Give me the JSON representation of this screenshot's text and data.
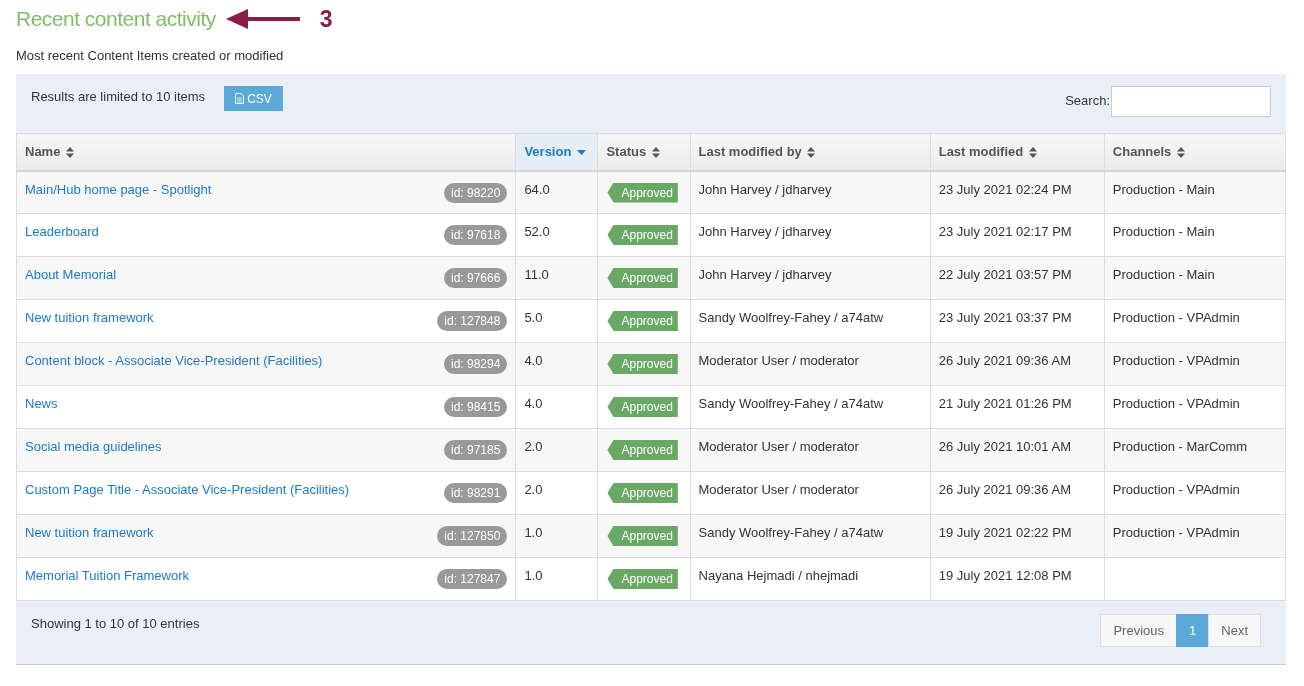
{
  "heading": "Recent content activity",
  "annotation": {
    "label": "3"
  },
  "subtitle": "Most recent Content Items created or modified",
  "toolbar": {
    "limit_text": "Results are limited to 10 items",
    "export_button": "CSV",
    "search_label": "Search:"
  },
  "table": {
    "columns": [
      {
        "label": "Name",
        "sorted": false
      },
      {
        "label": "Version",
        "sorted": true
      },
      {
        "label": "Status",
        "sorted": false
      },
      {
        "label": "Last modified by",
        "sorted": false
      },
      {
        "label": "Last modified",
        "sorted": false
      },
      {
        "label": "Channels",
        "sorted": false
      }
    ],
    "rows": [
      {
        "name": "Main/Hub home page - Spotlight",
        "id": "id: 98220",
        "version": "64.0",
        "status": "Approved",
        "modified_by": "John Harvey / jdharvey",
        "modified": "23 July 2021 02:24 PM",
        "channel": "Production - Main"
      },
      {
        "name": "Leaderboard",
        "id": "id: 97618",
        "version": "52.0",
        "status": "Approved",
        "modified_by": "John Harvey / jdharvey",
        "modified": "23 July 2021 02:17 PM",
        "channel": "Production - Main"
      },
      {
        "name": "About Memorial",
        "id": "id: 97666",
        "version": "11.0",
        "status": "Approved",
        "modified_by": "John Harvey / jdharvey",
        "modified": "22 July 2021 03:57 PM",
        "channel": "Production - Main"
      },
      {
        "name": "New tuition framework",
        "id": "id: 127848",
        "version": "5.0",
        "status": "Approved",
        "modified_by": "Sandy Woolfrey-Fahey / a74atw",
        "modified": "23 July 2021 03:37 PM",
        "channel": "Production - VPAdmin"
      },
      {
        "name": "Content block - Associate Vice-President (Facilities)",
        "id": "id: 98294",
        "version": "4.0",
        "status": "Approved",
        "modified_by": "Moderator User / moderator",
        "modified": "26 July 2021 09:36 AM",
        "channel": "Production - VPAdmin"
      },
      {
        "name": "News",
        "id": "id: 98415",
        "version": "4.0",
        "status": "Approved",
        "modified_by": "Sandy Woolfrey-Fahey / a74atw",
        "modified": "21 July 2021 01:26 PM",
        "channel": "Production - VPAdmin"
      },
      {
        "name": "Social media guidelines",
        "id": "id: 97185",
        "version": "2.0",
        "status": "Approved",
        "modified_by": "Moderator User / moderator",
        "modified": "26 July 2021 10:01 AM",
        "channel": "Production - MarComm"
      },
      {
        "name": "Custom Page Title - Associate Vice-President (Facilities)",
        "id": "id: 98291",
        "version": "2.0",
        "status": "Approved",
        "modified_by": "Moderator User / moderator",
        "modified": "26 July 2021 09:36 AM",
        "channel": "Production - VPAdmin"
      },
      {
        "name": "New tuition framework",
        "id": "id: 127850",
        "version": "1.0",
        "status": "Approved",
        "modified_by": "Sandy Woolfrey-Fahey / a74atw",
        "modified": "19 July 2021 02:22 PM",
        "channel": "Production - VPAdmin"
      },
      {
        "name": "Memorial Tuition Framework",
        "id": "id: 127847",
        "version": "1.0",
        "status": "Approved",
        "modified_by": "Nayana Hejmadi / nhejmadi",
        "modified": "19 July 2021 12:08 PM"
      }
    ]
  },
  "footer": {
    "info": "Showing 1 to 10 of 10 entries",
    "pages": [
      {
        "label": "Previous",
        "selected": false
      },
      {
        "label": "1",
        "selected": true
      },
      {
        "label": "Next",
        "selected": false
      }
    ]
  }
}
